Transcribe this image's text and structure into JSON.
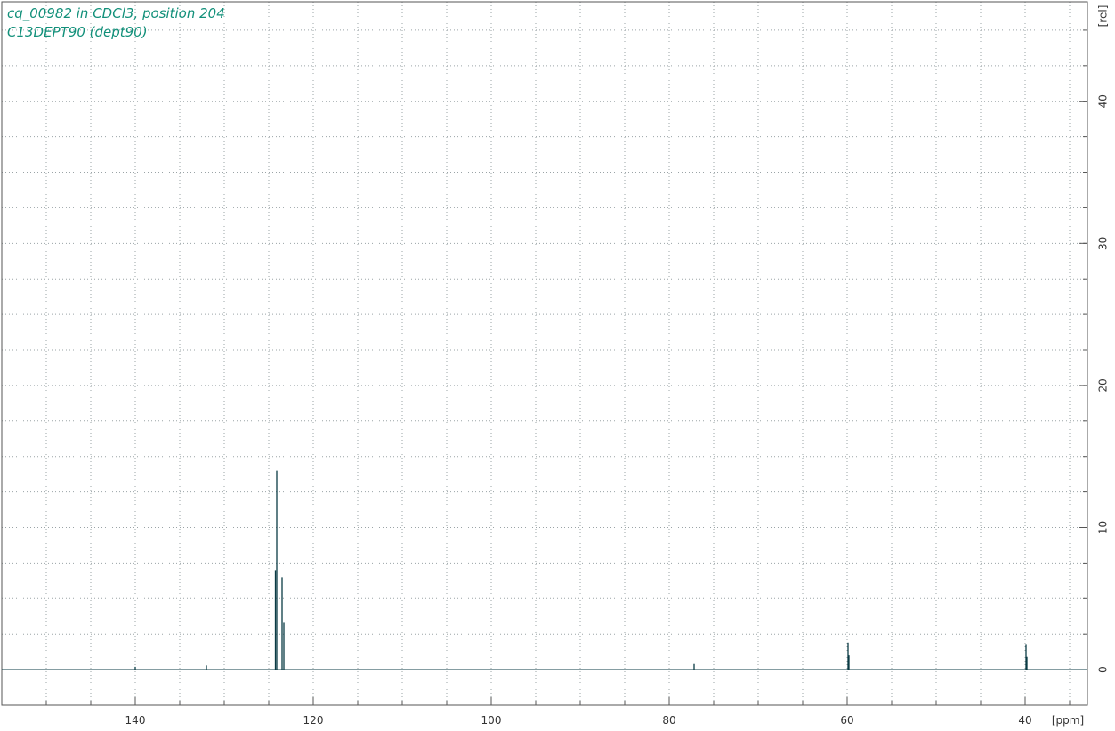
{
  "title_lines": [
    "cq_00982 in CDCl3, position 204",
    "C13DEPT90 (dept90)"
  ],
  "colors": {
    "title": "#12907a",
    "spectrum": "#0b3b44",
    "grid": "#9aa3a6",
    "frame": "#555555"
  },
  "chart_data": {
    "type": "line",
    "xlabel": "[ppm]",
    "ylabel": "[rel]",
    "xlim": [
      155,
      33
    ],
    "ylim": [
      -2.5,
      47
    ],
    "grid": true,
    "x_ticks": [
      140,
      120,
      100,
      80,
      60,
      40
    ],
    "y_ticks": [
      0,
      10,
      20,
      30,
      40
    ],
    "x_grid": [
      150,
      145,
      140,
      135,
      130,
      125,
      120,
      115,
      110,
      105,
      100,
      95,
      90,
      85,
      80,
      75,
      70,
      65,
      60,
      55,
      50,
      45,
      40,
      35
    ],
    "y_grid": [
      0,
      2.5,
      5,
      7.5,
      10,
      12.5,
      15,
      17.5,
      20,
      22.5,
      25,
      27.5,
      30,
      32.5,
      35,
      37.5,
      40,
      42.5,
      45
    ],
    "peaks": [
      {
        "ppm": 140.0,
        "intensity": 0.2
      },
      {
        "ppm": 132.0,
        "intensity": 0.3
      },
      {
        "ppm": 124.25,
        "intensity": 7.0
      },
      {
        "ppm": 124.1,
        "intensity": 14.0
      },
      {
        "ppm": 123.5,
        "intensity": 6.5
      },
      {
        "ppm": 123.3,
        "intensity": 3.3
      },
      {
        "ppm": 77.2,
        "intensity": 0.4
      },
      {
        "ppm": 59.9,
        "intensity": 1.9
      },
      {
        "ppm": 59.8,
        "intensity": 1.0
      },
      {
        "ppm": 39.9,
        "intensity": 1.8
      },
      {
        "ppm": 39.8,
        "intensity": 0.9
      }
    ]
  }
}
